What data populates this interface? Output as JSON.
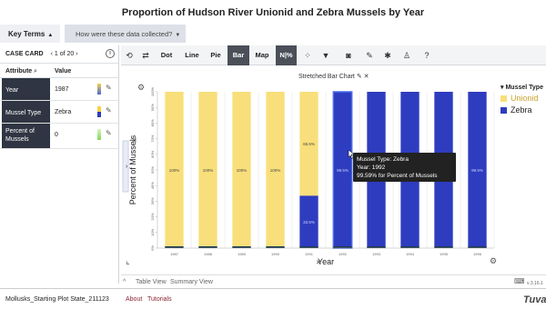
{
  "page_title": "Proportion of Hudson River Unionid and Zebra Mussels by Year",
  "top_bar": {
    "key_terms": "Key Terms",
    "how_collected": "How were these data collected?"
  },
  "case_card": {
    "title": "CASE CARD",
    "nav": "1 of 20",
    "col_attribute": "Attribute",
    "col_value": "Value",
    "rows": [
      {
        "attribute": "Year",
        "value": "1987",
        "swatch": "#4b6bd6"
      },
      {
        "attribute": "Mussel Type",
        "value": "Zebra",
        "swatch": "#f5d24a"
      },
      {
        "attribute": "Percent of Mussels",
        "value": "0",
        "swatch": "#7ed957"
      }
    ]
  },
  "toolbar": {
    "dot": "Dot",
    "line": "Line",
    "pie": "Pie",
    "bar": "Bar",
    "map": "Map",
    "n_pct": "N|%",
    "active": "Bar",
    "icons": [
      "history-icon",
      "swap-icon",
      "scatter-icon",
      "filter-icon",
      "camera-icon",
      "brush-icon",
      "gear-icon",
      "person-icon",
      "help-icon"
    ]
  },
  "plot": {
    "title": "Stretched Bar Chart",
    "ylabel": "Percent of Mussels",
    "xlabel": "Year",
    "y_ticks": [
      "100%",
      "90%",
      "80%",
      "70%",
      "60%",
      "50%",
      "40%",
      "30%",
      "20%",
      "10%",
      "0%"
    ],
    "version": "v 3.16.1"
  },
  "legend": {
    "title": "Mussel Type",
    "items": [
      {
        "label": "Unionid",
        "color": "#f9df7b"
      },
      {
        "label": "Zebra",
        "color": "#2e3cbf"
      }
    ]
  },
  "chart_data": {
    "type": "bar",
    "title": "Stretched Bar Chart",
    "xlabel": "Year",
    "ylabel": "Percent of Mussels",
    "ylim": [
      0,
      100
    ],
    "categories": [
      "1987",
      "1988",
      "1989",
      "1990",
      "1991",
      "1992",
      "1993",
      "1994",
      "1995",
      "1996"
    ],
    "series": [
      {
        "name": "Unionid",
        "color": "#f9df7b",
        "values": [
          100,
          100,
          100,
          100,
          66.5,
          0,
          0,
          0,
          0,
          0
        ]
      },
      {
        "name": "Zebra",
        "color": "#2e3cbf",
        "values": [
          0,
          0,
          0,
          0,
          33.5,
          100,
          100,
          100,
          100,
          100
        ]
      }
    ],
    "data_labels": [
      "100%",
      "100%",
      "100%",
      "100%",
      "66.5%",
      "99.5%",
      "99.5%",
      "99.5%",
      "99.5%",
      "99.5%"
    ],
    "zebra_labels": [
      "",
      "",
      "",
      "",
      "33.5%",
      "",
      "",
      "",
      "",
      ""
    ],
    "x_labels": [
      "1987",
      "1988",
      "1989",
      "1990",
      "1991",
      "1992",
      "1993",
      "1994",
      "1995",
      "1996"
    ],
    "highlight_index": 5
  },
  "tooltip": {
    "line1": "Mussel Type: Zebra",
    "line2": "Year: 1992",
    "line3": "99.59% for Percent of Mussels"
  },
  "bottom_tabs": {
    "table": "Table View",
    "summary": "Summary View"
  },
  "footer": {
    "file": "Mollusks_Starting Plot State_211123",
    "about": "About",
    "tutorials": "Tutorials",
    "logo": "Tuva"
  }
}
